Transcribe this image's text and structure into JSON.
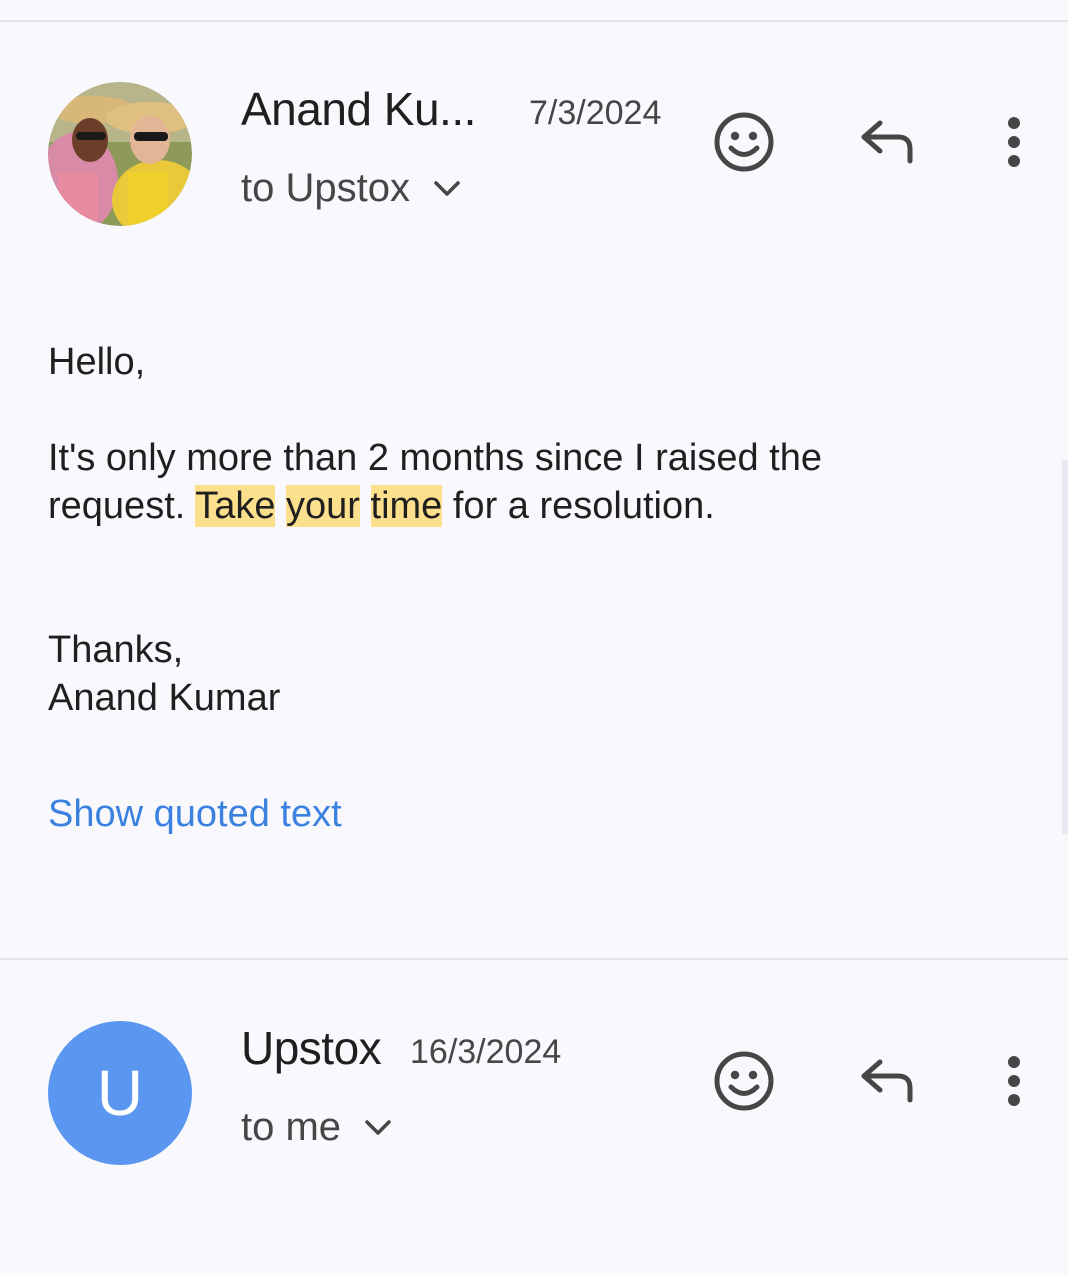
{
  "messages": [
    {
      "sender": "Anand Ku...",
      "date": "7/3/2024",
      "recipient": "to Upstox",
      "avatar_letter": "",
      "body": {
        "greeting": "Hello,",
        "line1": "It's only more than 2 months since I raised the",
        "line2_prefix": "request.",
        "highlight_words": [
          "Take",
          "your",
          "time"
        ],
        "line2_suffix": "for a resolution.",
        "signoff": "Thanks,",
        "signature": "Anand Kumar"
      },
      "show_quoted_text": "Show quoted text"
    },
    {
      "sender": "Upstox",
      "date": "16/3/2024",
      "recipient": "to me",
      "avatar_letter": "U",
      "avatar_color": "#5b97f0"
    }
  ],
  "icons": {
    "emoji": "smiley-icon",
    "reply": "reply-icon",
    "more": "more-vert-icon",
    "expand": "chevron-down-icon"
  },
  "colors": {
    "background": "#f8f8fd",
    "link": "#3b82e0",
    "highlight": "#fce08d",
    "avatar_u": "#5b97f0"
  }
}
